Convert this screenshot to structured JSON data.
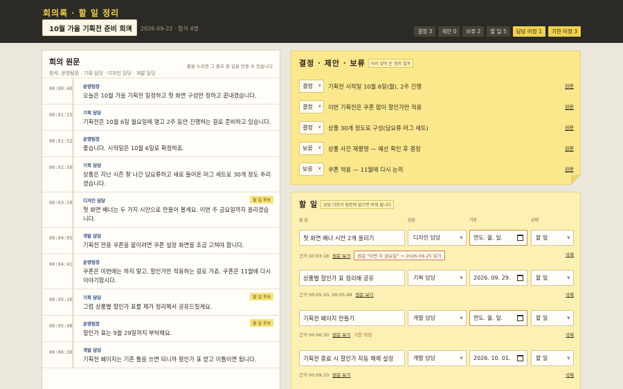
{
  "header": {
    "app_title": "회의록 · 할 일 정리",
    "meeting_selected": "10월 가을 기획전 준비 회의",
    "meeting_meta": "2026-09-22 · 참석 4명",
    "counters": [
      {
        "label": "결정 3",
        "warn": false
      },
      {
        "label": "제안 0",
        "warn": false
      },
      {
        "label": "보류 2",
        "warn": false
      },
      {
        "label": "할 일 5",
        "warn": false
      },
      {
        "label": "담당 미정 1",
        "warn": true
      },
      {
        "label": "기한 미정 3",
        "warn": true
      }
    ]
  },
  "transcript": {
    "title": "회의 원문",
    "participants": "참석: 운영팀장 · 기획 담당 · 디자인 담당 · 개발 담당",
    "hint": "줄을 누르면 그 줄로 할 일을 만들 수 있습니다",
    "todo_tag": "할 일 후보",
    "rows": [
      {
        "time": "00:00:40",
        "speaker": "운영팀장",
        "text": "오늘은 10월 가을 기획전 일정하고 첫 화면 구성만 정하고 끝내겠습니다.",
        "todo": false
      },
      {
        "time": "00:01:15",
        "speaker": "기획 담당",
        "text": "기획전은 10월 6일 월요일에 열고 2주 동안 진행하는 걸로 준비하고 있습니다.",
        "todo": false
      },
      {
        "time": "00:01:52",
        "speaker": "운영팀장",
        "text": "좋습니다. 시작일은 10월 6일로 확정하죠.",
        "todo": false
      },
      {
        "time": "00:02:30",
        "speaker": "기획 담당",
        "text": "상품은 지난 시즌 잘 나간 담요류하고 새로 들어온 머그 세트로 30개 정도 추리겠습니다.",
        "todo": false
      },
      {
        "time": "00:03:18",
        "speaker": "디자인 담당",
        "text": "첫 화면 배너는 두 가지 시안으로 만들어 볼게요. 이번 주 금요일까지 올리겠습니다.",
        "todo": true
      },
      {
        "time": "00:04:05",
        "speaker": "개발 담당",
        "text": "기획전 전용 쿠폰을 붙이려면 쿠폰 설정 화면을 조금 고쳐야 합니다.",
        "todo": false
      },
      {
        "time": "00:04:41",
        "speaker": "운영팀장",
        "text": "쿠폰은 이번에는 하지 말고, 할인가만 적용하는 걸로 가죠. 쿠폰은 11월에 다시 이야기합시다.",
        "todo": false
      },
      {
        "time": "00:05:20",
        "speaker": "기획 담당",
        "text": "그럼 상품별 할인가 표를 제가 정리해서 공유드릴게요.",
        "todo": true
      },
      {
        "time": "00:05:48",
        "speaker": "운영팀장",
        "text": "할인가 표는 9월 29일까지 부탁해요.",
        "todo": true
      },
      {
        "time": "00:06:30",
        "speaker": "개발 담당",
        "text": "기획전 페이지는 기존 틀을 쓰면 되니까 할인가 표 받고 이틀이면 됩니다.",
        "todo": false
      }
    ]
  },
  "decisions": {
    "title": "결정 · 제안 · 보류",
    "note": "미리 넣어 둔 정리 결과",
    "link_label": "원문",
    "items": [
      {
        "type": "결정",
        "text": "기획전 시작일 10월 6일(월), 2주 진행"
      },
      {
        "type": "결정",
        "text": "이번 기획전은 쿠폰 없이 할인가만 적용"
      },
      {
        "type": "결정",
        "text": "상품 30개 정도로 구성(담요류·머그 세트)"
      },
      {
        "type": "보류",
        "text": "상품 사진 재촬영 — 예산 확인 후 결정"
      },
      {
        "type": "보류",
        "text": "쿠폰 적용 — 11월에 다시 논의"
      }
    ]
  },
  "todos": {
    "title": "할 일",
    "note": "담당·기한이 원문에 없으면 비워 둡니다",
    "col_task": "할 일",
    "col_owner": "담당",
    "col_due": "기한",
    "col_status": "상태",
    "source_label": "원문 보기",
    "delete_label": "삭제",
    "items": [
      {
        "task": "첫 화면 배너 시안 2개 올리기",
        "owner": "디자인 담당",
        "due": "연도. 월. 일.",
        "due_empty": true,
        "status": "할 일",
        "ref": "근거 00:03:18",
        "badge": "원문 \"이번 주 금요일\" → 2026-09-25 넣기",
        "warn": ""
      },
      {
        "task": "상품별 할인가 표 정리해 공유",
        "owner": "기획 담당",
        "due": "2026. 09. 29.",
        "due_empty": false,
        "status": "할 일",
        "ref": "근거 00:05:20, 00:05:48",
        "badge": "",
        "warn": ""
      },
      {
        "task": "기획전 페이지 만들기",
        "owner": "개발 담당",
        "due": "연도. 월. 일.",
        "due_empty": true,
        "status": "할 일",
        "ref": "근거 00:06:30",
        "badge": "",
        "warn": "기한 미정"
      },
      {
        "task": "기획전 종료 시 할인가 자동 해제 설정",
        "owner": "개발 담당",
        "due": "2026. 10. 01.",
        "due_empty": false,
        "status": "할 일",
        "ref": "근거 00:09:10",
        "badge": "",
        "warn": ""
      }
    ]
  }
}
